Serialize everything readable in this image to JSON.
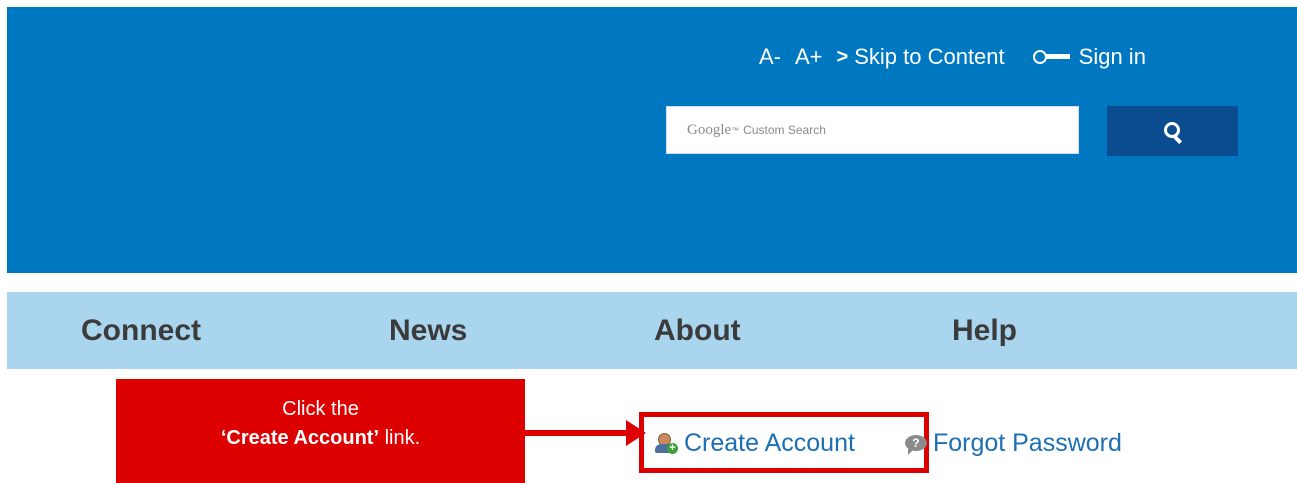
{
  "header": {
    "font_decrease": "A-",
    "font_increase": "A+",
    "skip_chevron": ">",
    "skip_to_content": "Skip to Content",
    "sign_in": "Sign in",
    "search": {
      "brand": "Google",
      "trademark": "™",
      "placeholder_suffix": "Custom Search"
    },
    "colors": {
      "header_bg": "#0078c1",
      "search_button_bg": "#0a4c8f"
    }
  },
  "nav": {
    "items": [
      {
        "label": "Connect"
      },
      {
        "label": "News"
      },
      {
        "label": "About"
      },
      {
        "label": "Help"
      }
    ],
    "colors": {
      "nav_bg": "#aad5ee"
    }
  },
  "callout": {
    "line1": "Click the",
    "highlight": "‘Create Account’",
    "line2_suffix": " link.",
    "color": "#dd0000"
  },
  "login_links": {
    "create_account": "Create Account",
    "forgot_password": "Forgot Password",
    "link_color": "#1c6fb4"
  },
  "icons": {
    "key": "key-icon",
    "search": "search-icon",
    "user_add": "user-add-icon",
    "question": "question-bubble-icon"
  }
}
